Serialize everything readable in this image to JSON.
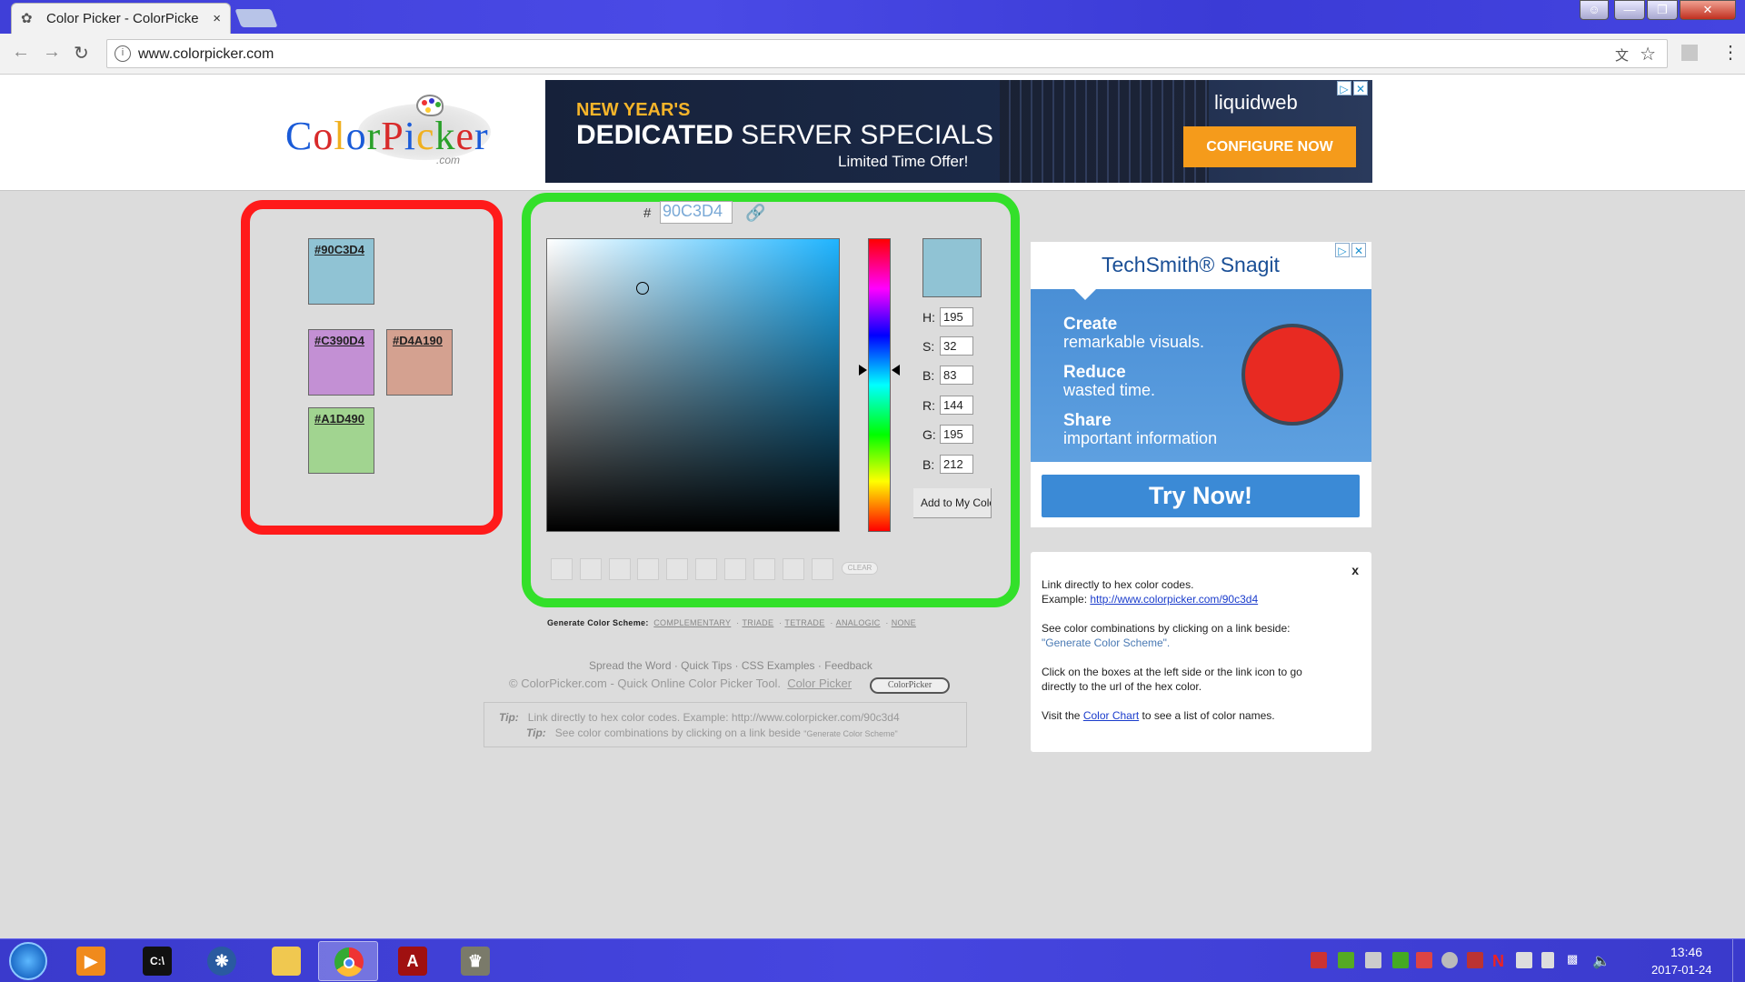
{
  "browser": {
    "tab_title": "Color Picker - ColorPicke",
    "tab_close": "×",
    "url": "www.colorpicker.com",
    "window_controls": [
      "user-icon",
      "minimize-icon",
      "maximize-icon",
      "close-icon"
    ]
  },
  "header": {
    "logo_text": "ColorPicker",
    "logo_sub": ".com",
    "ad": {
      "line1": "NEW YEAR'S",
      "line2_bold": "DEDICATED",
      "line2_rest": " SERVER SPECIALS",
      "line3": "Limited Time Offer!",
      "brand": "liquidweb",
      "cta": "CONFIGURE NOW"
    }
  },
  "saved_colors": [
    {
      "hex": "#90C3D4",
      "color": "#90C3D4"
    },
    {
      "hex": "#C390D4",
      "color": "#C390D4"
    },
    {
      "hex": "#D4A190",
      "color": "#D4A190"
    },
    {
      "hex": "#A1D490",
      "color": "#A1D490"
    }
  ],
  "picker": {
    "hash": "#",
    "hex_value": "90C3D4",
    "preview_color": "#90C3D4",
    "fields": [
      {
        "label": "H:",
        "value": "195"
      },
      {
        "label": "S:",
        "value": "32"
      },
      {
        "label": "B:",
        "value": "83"
      },
      {
        "label": "R:",
        "value": "144"
      },
      {
        "label": "G:",
        "value": "195"
      },
      {
        "label": "B:",
        "value": "212"
      }
    ],
    "add_button": "Add to My Colo",
    "clear_button": "CLEAR",
    "mini_slots": 10
  },
  "scheme": {
    "label": "Generate Color Scheme:",
    "options": [
      "COMPLEMENTARY",
      "TRIADE",
      "TETRADE",
      "ANALOGIC",
      "NONE"
    ]
  },
  "footer": {
    "links": [
      "Spread the Word",
      "Quick Tips",
      "CSS Examples",
      "Feedback"
    ],
    "copyright": "© ColorPicker.com - Quick Online Color Picker Tool.",
    "copyright_link": "Color Picker",
    "badge": "ColorPicker",
    "tip1_label": "Tip:",
    "tip1_text": "Link directly to hex color codes.   Example: http://www.colorpicker.com/90c3d4",
    "tip2_label": "Tip:",
    "tip2_text": "See color combinations by clicking on a link beside",
    "tip2_small": "\"Generate Color Scheme\""
  },
  "ad_right": {
    "brand": "TechSmith® Snagit",
    "items": [
      {
        "head": "Create",
        "body": "remarkable visuals."
      },
      {
        "head": "Reduce",
        "body": "wasted time."
      },
      {
        "head": "Share",
        "body": "important information"
      }
    ],
    "cta": "Try Now!"
  },
  "info_box": {
    "close": "x",
    "line1": "Link directly to hex color codes.",
    "line2_prefix": "Example: ",
    "line2_link": "http://www.colorpicker.com/90c3d4",
    "line3": "See color combinations by clicking on a link beside:",
    "line4": "\"Generate Color Scheme\".",
    "line5": "Click on the boxes at the left side or the link icon to go",
    "line6": "directly to the url of the hex color.",
    "line7_prefix": "Visit the ",
    "line7_link": "Color Chart",
    "line7_suffix": " to see a list of color names."
  },
  "taskbar": {
    "apps": [
      "media-player",
      "command-prompt",
      "network-app",
      "file-explorer",
      "chrome",
      "acrobat-reader",
      "gimp"
    ],
    "active_app": "chrome",
    "time": "13:46",
    "date": "2017-01-24"
  }
}
